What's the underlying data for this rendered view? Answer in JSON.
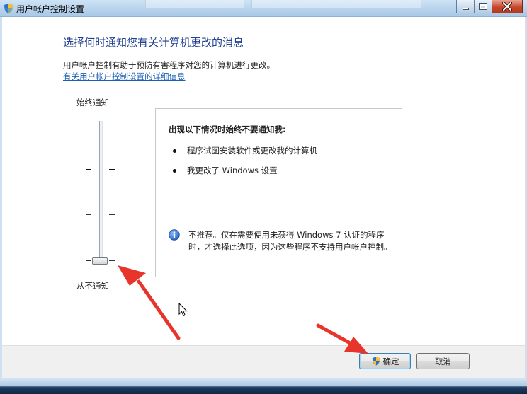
{
  "window": {
    "title": "用户帐户控制设置"
  },
  "main": {
    "heading": "选择何时通知您有关计算机更改的消息",
    "description": "用户帐户控制有助于预防有害程序对您的计算机进行更改。",
    "help_link": "有关用户帐户控制设置的详细信息"
  },
  "slider": {
    "top_label": "始终通知",
    "bottom_label": "从不通知",
    "levels": 4,
    "selected_level": 0
  },
  "panel": {
    "title": "出现以下情况时始终不要通知我:",
    "bullets": [
      "程序试图安装软件或更改我的计算机",
      "我更改了 Windows 设置"
    ],
    "note": "不推荐。仅在需要使用未获得 Windows 7 认证的程序时，才选择此选项，因为这些程序不支持用户帐户控制。"
  },
  "buttons": {
    "ok_label": "确定",
    "cancel_label": "取消"
  },
  "colors": {
    "heading": "#1f3f8f",
    "link": "#1a5fb4",
    "annotation_arrow": "#e8352b"
  },
  "icons": {
    "app": "uac-shield-icon",
    "info": "info-icon",
    "ok_button": "uac-shield-icon",
    "cursor": "mouse-pointer-icon"
  }
}
